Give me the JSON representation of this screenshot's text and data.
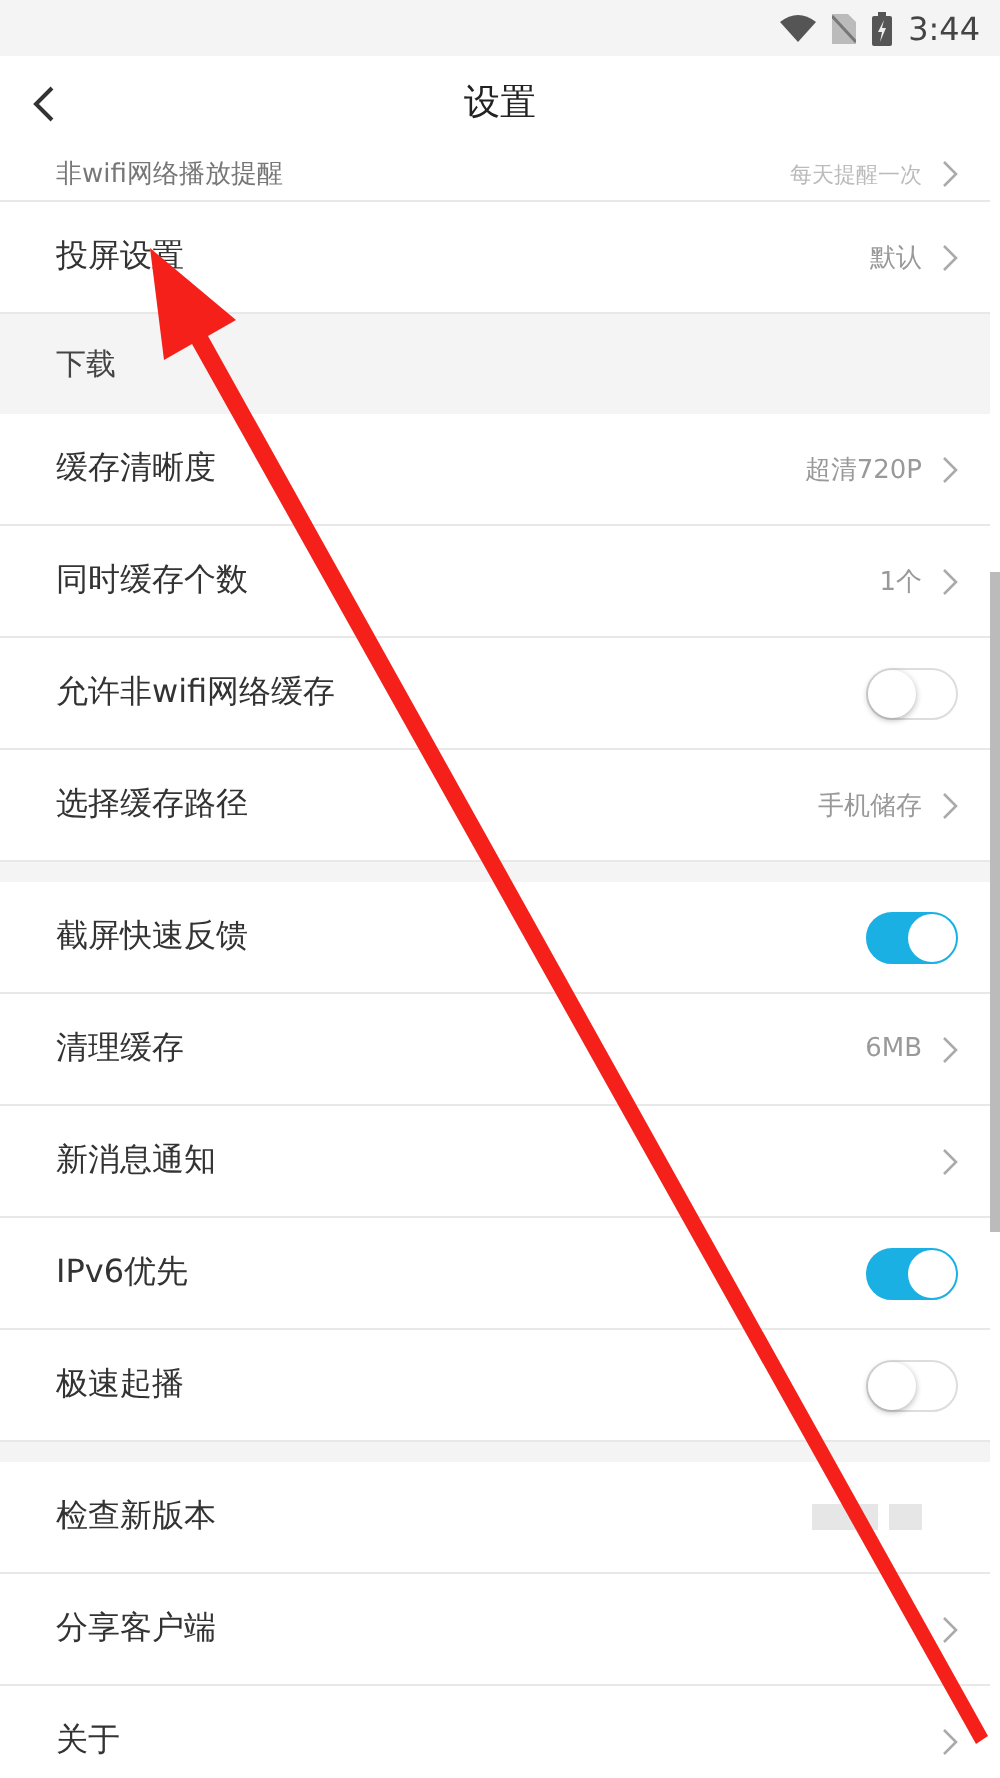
{
  "status_bar": {
    "time": "3:44"
  },
  "header": {
    "title": "设置"
  },
  "sections": [
    {
      "rows": [
        {
          "kind": "value",
          "label": "非wifi网络播放提醒",
          "value": "每天提醒一次",
          "partial": true
        },
        {
          "kind": "value",
          "label": "投屏设置",
          "value": "默认"
        }
      ]
    },
    {
      "title": "下载",
      "rows": [
        {
          "kind": "value",
          "label": "缓存清晰度",
          "value": "超清720P"
        },
        {
          "kind": "value",
          "label": "同时缓存个数",
          "value": "1个"
        },
        {
          "kind": "toggle",
          "label": "允许非wifi网络缓存",
          "on": false
        },
        {
          "kind": "value",
          "label": "选择缓存路径",
          "value": "手机储存"
        }
      ]
    },
    {
      "rows": [
        {
          "kind": "toggle",
          "label": "截屏快速反馈",
          "on": true
        },
        {
          "kind": "value",
          "label": "清理缓存",
          "value": "6MB"
        },
        {
          "kind": "chevron",
          "label": "新消息通知"
        },
        {
          "kind": "toggle",
          "label": "IPv6优先",
          "on": true
        },
        {
          "kind": "toggle",
          "label": "极速起播",
          "on": false
        }
      ]
    },
    {
      "rows": [
        {
          "kind": "hidden",
          "label": "检查新版本"
        },
        {
          "kind": "chevron",
          "label": "分享客户端"
        },
        {
          "kind": "chevron",
          "label": "关于"
        }
      ]
    }
  ]
}
